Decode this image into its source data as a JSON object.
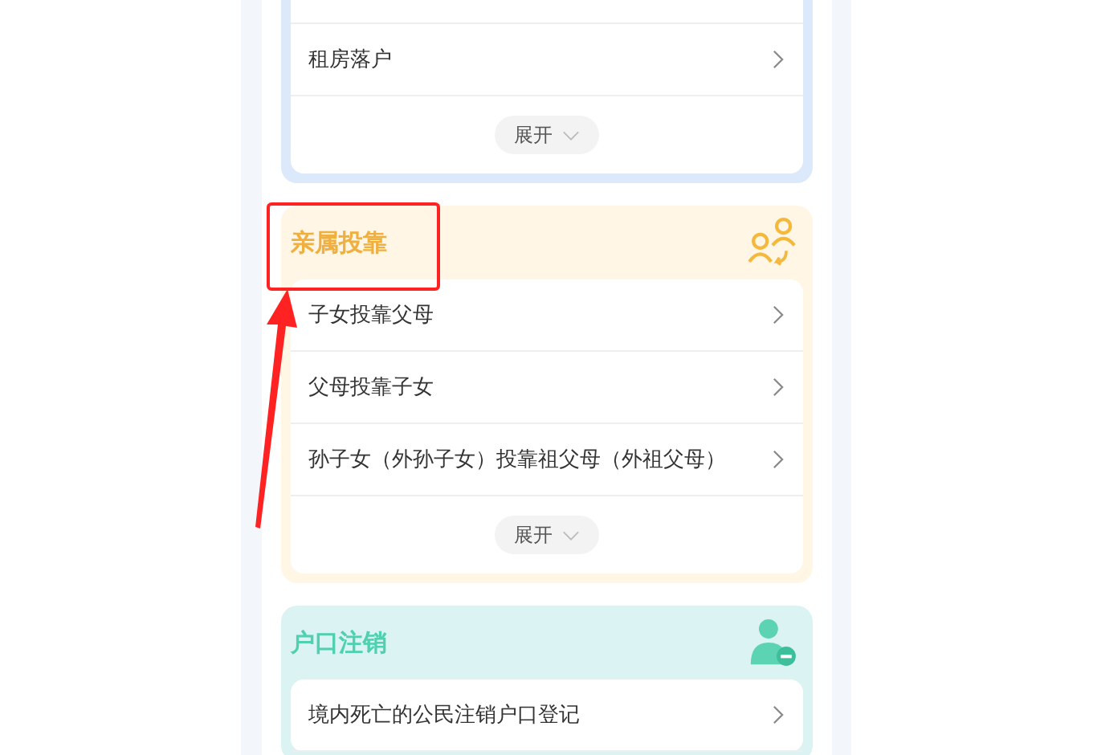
{
  "sections": [
    {
      "kind": "settle",
      "items": [
        "租房落户"
      ],
      "expand_label": "展开"
    },
    {
      "kind": "relatives",
      "title": "亲属投靠",
      "items": [
        "子女投靠父母",
        "父母投靠子女",
        "孙子女（外孙子女）投靠祖父母（外祖父母）"
      ],
      "expand_label": "展开"
    },
    {
      "kind": "cancel",
      "title": "户口注销",
      "items": [
        "境内死亡的公民注销户口登记"
      ]
    }
  ]
}
